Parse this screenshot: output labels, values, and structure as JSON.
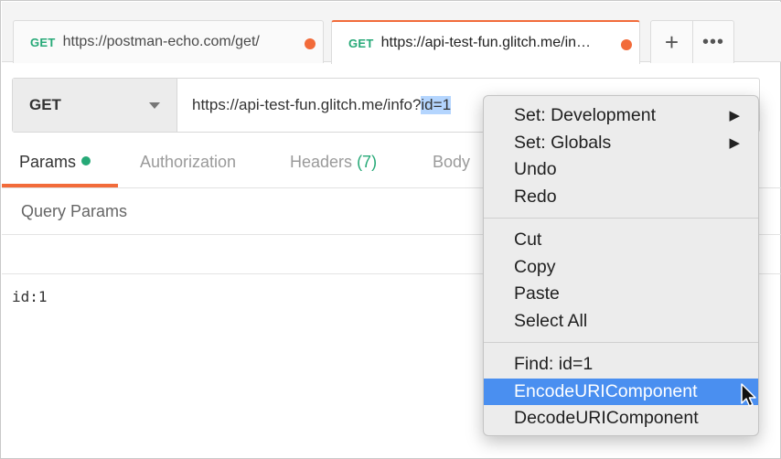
{
  "tabs": [
    {
      "method": "GET",
      "url": "https://postman-echo.com/get/"
    },
    {
      "method": "GET",
      "url": "https://api-test-fun.glitch.me/in…"
    }
  ],
  "tab_controls": {
    "add": "+",
    "more": "•••"
  },
  "request": {
    "method": "GET",
    "url_prefix": "https://api-test-fun.glitch.me/info?",
    "url_selected": "id=1"
  },
  "subtabs": {
    "params": "Params",
    "authorization": "Authorization",
    "headers": "Headers",
    "headers_count": "(7)",
    "body": "Body"
  },
  "query_params_label": "Query Params",
  "bulk_edit_text": "id:1",
  "context_menu": {
    "group1": [
      {
        "label": "Set: Development",
        "submenu": "▶"
      },
      {
        "label": "Set: Globals",
        "submenu": "▶"
      },
      {
        "label": "Undo"
      },
      {
        "label": "Redo"
      }
    ],
    "group2": [
      {
        "label": "Cut"
      },
      {
        "label": "Copy"
      },
      {
        "label": "Paste"
      },
      {
        "label": "Select All"
      }
    ],
    "group3": [
      {
        "label": "Find: id=1"
      },
      {
        "label": "EncodeURIComponent",
        "highlighted": true
      },
      {
        "label": "DecodeURIComponent"
      }
    ]
  },
  "colors": {
    "accent": "#f26b3a",
    "method_green": "#26a977",
    "menu_highlight": "#4a8ff0",
    "selection": "#b4d5fe"
  }
}
